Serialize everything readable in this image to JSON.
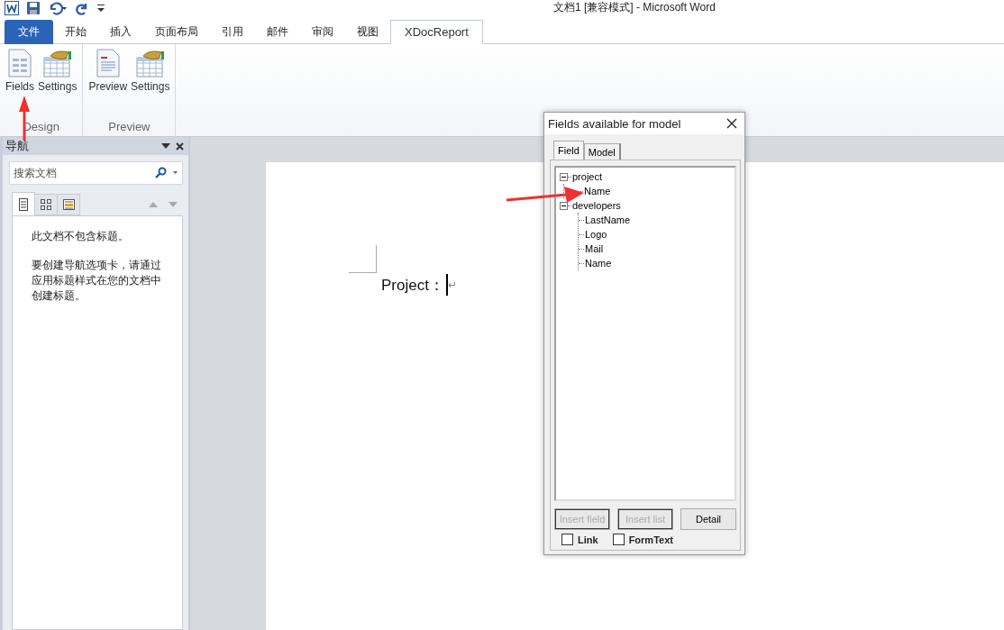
{
  "window": {
    "title": "文档1 [兼容模式]  -  Microsoft Word"
  },
  "ribbon_tabs": [
    {
      "label": "文件",
      "kind": "file",
      "selected": false
    },
    {
      "label": "开始",
      "kind": "tab",
      "selected": false
    },
    {
      "label": "插入",
      "kind": "tab",
      "selected": false
    },
    {
      "label": "页面布局",
      "kind": "tab",
      "selected": false
    },
    {
      "label": "引用",
      "kind": "tab",
      "selected": false
    },
    {
      "label": "邮件",
      "kind": "tab",
      "selected": false
    },
    {
      "label": "审阅",
      "kind": "tab",
      "selected": false
    },
    {
      "label": "视图",
      "kind": "tab",
      "selected": false
    },
    {
      "label": "XDocReport",
      "kind": "tab",
      "selected": true
    }
  ],
  "ribbon_groups": [
    {
      "label": "Design",
      "buttons": [
        {
          "label": "Fields",
          "kind": "form"
        },
        {
          "label": "Settings",
          "kind": "grid"
        }
      ]
    },
    {
      "label": "Preview",
      "buttons": [
        {
          "label": "Preview",
          "kind": "doc"
        },
        {
          "label": "Settings",
          "kind": "grid"
        }
      ]
    }
  ],
  "navigation": {
    "title": "导航",
    "search": {
      "placeholder": "搜索文档"
    },
    "tabs": [
      {
        "kind": "headings",
        "selected": true
      },
      {
        "kind": "pages",
        "selected": false
      },
      {
        "kind": "results",
        "selected": false
      }
    ],
    "message": "此文档不包含标题。",
    "hint": "要创建导航选项卡，请通过应用标题样式在您的文档中创建标题。"
  },
  "document": {
    "text": "Project：",
    "paragraph_mark": "↵"
  },
  "dialog": {
    "title": "Fields available for model",
    "tabs": [
      {
        "label": "Field",
        "selected": true
      },
      {
        "label": "Model",
        "selected": false
      }
    ],
    "tree": [
      {
        "label": "project",
        "expanded": true,
        "children": [
          {
            "label": "Name"
          }
        ]
      },
      {
        "label": "developers",
        "expanded": true,
        "children": [
          {
            "label": "LastName"
          },
          {
            "label": "Logo"
          },
          {
            "label": "Mail"
          },
          {
            "label": "Name"
          }
        ]
      }
    ],
    "buttons": [
      {
        "label": "Insert field",
        "disabled": true
      },
      {
        "label": "Insert list",
        "disabled": true
      },
      {
        "label": "Detail",
        "disabled": false
      }
    ],
    "checkboxes": [
      {
        "label": "Link",
        "checked": false
      },
      {
        "label": "FormText",
        "checked": false
      }
    ]
  }
}
